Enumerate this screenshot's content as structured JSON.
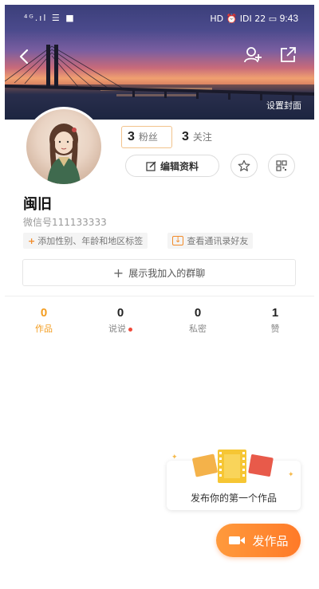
{
  "status_bar": {
    "left_text": "⁴ᴳ.ıl ☰ ■",
    "right_text": "HD ⏰ IDI 22 ▭",
    "time": "9:43"
  },
  "header": {
    "cover_label": "设置封面"
  },
  "profile": {
    "fans_count": "3",
    "fans_label": "粉丝",
    "follow_count": "3",
    "follow_label": "关注",
    "edit_label": "编辑资料",
    "username": "闽旧",
    "wechat_id": "微信号111133333",
    "tags": [
      {
        "label": "添加性别、年龄和地区标签"
      },
      {
        "label": "查看通讯录好友"
      }
    ],
    "group_label": "展示我加入的群聊"
  },
  "tabs": [
    {
      "count": "0",
      "label": "作品"
    },
    {
      "count": "0",
      "label": "说说"
    },
    {
      "count": "0",
      "label": "私密"
    },
    {
      "count": "1",
      "label": "赞"
    }
  ],
  "prompt": {
    "text": "发布你的第一个作品"
  },
  "publish_button": {
    "label": "发作品"
  },
  "icons": {
    "back": "back-arrow-icon",
    "add_user": "add-user-icon",
    "share": "share-icon",
    "edit": "edit-icon",
    "star": "star-icon",
    "qr": "qr-code-icon",
    "camera": "video-camera-icon"
  },
  "colors": {
    "accent": "#f39c1e",
    "publish": "#ff8a30",
    "dot": "#f04a3a"
  }
}
